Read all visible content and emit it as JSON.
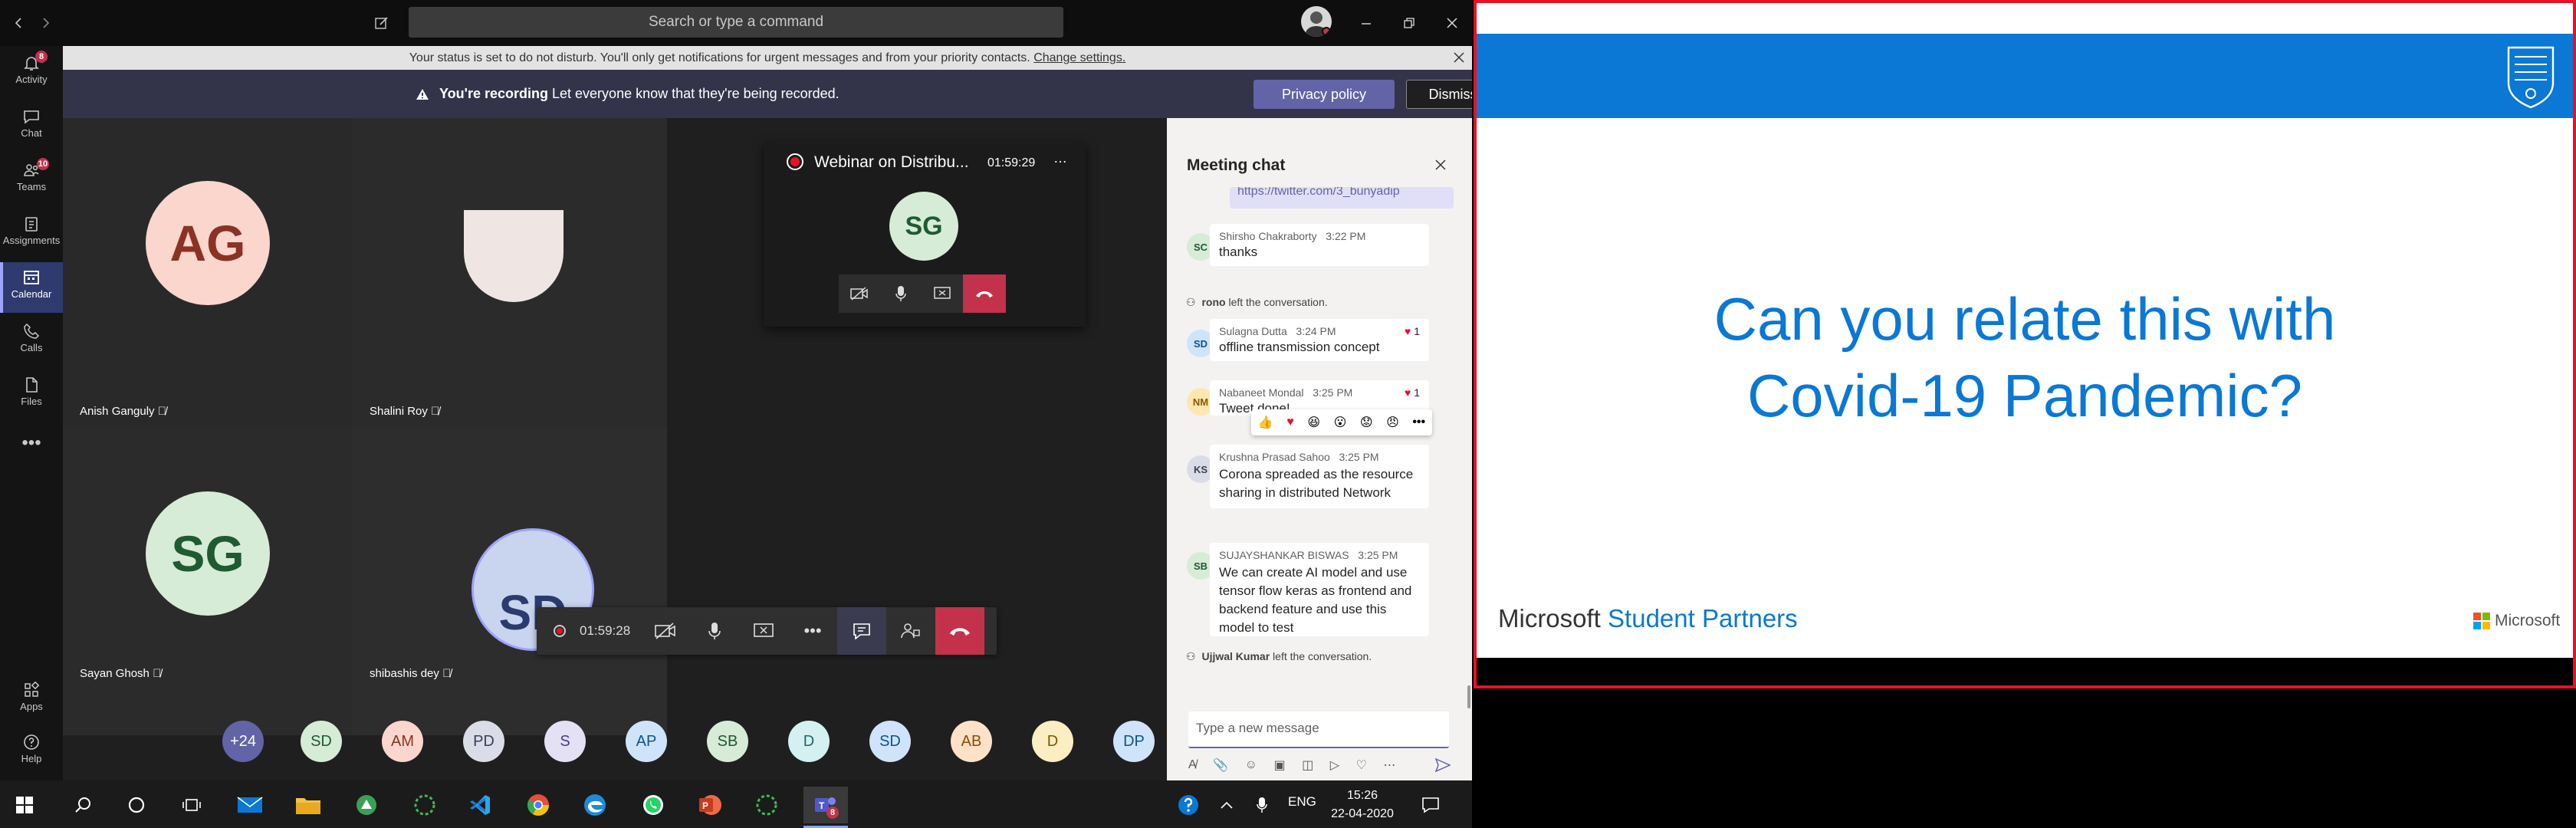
{
  "window": {
    "search_placeholder": "Search or type a command",
    "notification": "Your status is set to do not disturb. You'll only get notifications for urgent messages and from your priority contacts.",
    "notification_link": "Change settings.",
    "recording_bold": "You're recording",
    "recording_text": "Let everyone know that they're being recorded.",
    "privacy_label": "Privacy policy",
    "dismiss_label": "Dismiss"
  },
  "rail": {
    "items": [
      {
        "label": "Activity",
        "badge": "8",
        "icon": "bell-icon"
      },
      {
        "label": "Chat",
        "icon": "chat-icon"
      },
      {
        "label": "Teams",
        "badge": "10",
        "icon": "teams-icon"
      },
      {
        "label": "Assignments",
        "icon": "assignments-icon"
      },
      {
        "label": "Calendar",
        "icon": "calendar-icon"
      },
      {
        "label": "Calls",
        "icon": "phone-icon"
      },
      {
        "label": "Files",
        "icon": "files-icon"
      },
      {
        "label": "Apps",
        "icon": "apps-icon"
      },
      {
        "label": "Help",
        "icon": "help-icon"
      }
    ]
  },
  "participants": {
    "tiles": [
      {
        "initials": "AG",
        "name": "Anish Ganguly"
      },
      {
        "initials": "",
        "name": "Shalini Roy"
      },
      {
        "initials": "SG",
        "name": "Sayan Ghosh"
      },
      {
        "initials": "SD",
        "name": "shibashis dey"
      }
    ],
    "overflow_count": "+24",
    "bubbles": [
      "SD",
      "AM",
      "PD",
      "S",
      "AP",
      "SB",
      "D",
      "SD",
      "AB",
      "D",
      "DP"
    ]
  },
  "mini_window": {
    "title": "Webinar on Distribu...",
    "timer": "01:59:29",
    "initials": "SG"
  },
  "call_bar": {
    "timer": "01:59:28"
  },
  "chat": {
    "title": "Meeting chat",
    "link_text": "https://twitter.com/3_bunyadip",
    "messages": [
      {
        "initials": "SC",
        "author": "Shirsho Chakraborty",
        "time": "3:22 PM",
        "text": "thanks"
      },
      {
        "initials": "SD",
        "author": "Sulagna Dutta",
        "time": "3:24 PM",
        "text": "offline transmission concept",
        "likes": "1"
      },
      {
        "initials": "NM",
        "author": "Nabaneet Mondal",
        "time": "3:25 PM",
        "text": "Tweet done!",
        "likes": "1"
      },
      {
        "initials": "KS",
        "author": "Krushna Prasad Sahoo",
        "time": "3:25 PM",
        "text": "Corona spreaded as the resource sharing in distributed Network"
      },
      {
        "initials": "SB",
        "author": "SUJAYSHANKAR BISWAS",
        "time": "3:25 PM",
        "text": "We can create AI model and use tensor flow keras as frontend and backend feature and use this model to test"
      }
    ],
    "system_1_name": "rono",
    "system_1_text": "left the conversation.",
    "system_2_name": "Ujjwal Kumar",
    "system_2_text": "left the conversation.",
    "compose_placeholder": "Type a new message"
  },
  "taskbar": {
    "language": "ENG",
    "time": "15:26",
    "date": "22-04-2020",
    "teams_badge": "8"
  },
  "slide": {
    "title_line1": "Can you relate this with",
    "title_line2": "Covid-19 Pandemic?",
    "footer_ms": "Microsoft",
    "footer_sp": "Student Partners",
    "footer_logo_text": "Microsoft",
    "colors": {
      "band": "#0a78d4",
      "title": "#0a78d4",
      "border": "#e81123"
    }
  },
  "colors": {
    "accent": "#6264a7",
    "hangup": "#c4314b",
    "recording": "#33344a"
  }
}
